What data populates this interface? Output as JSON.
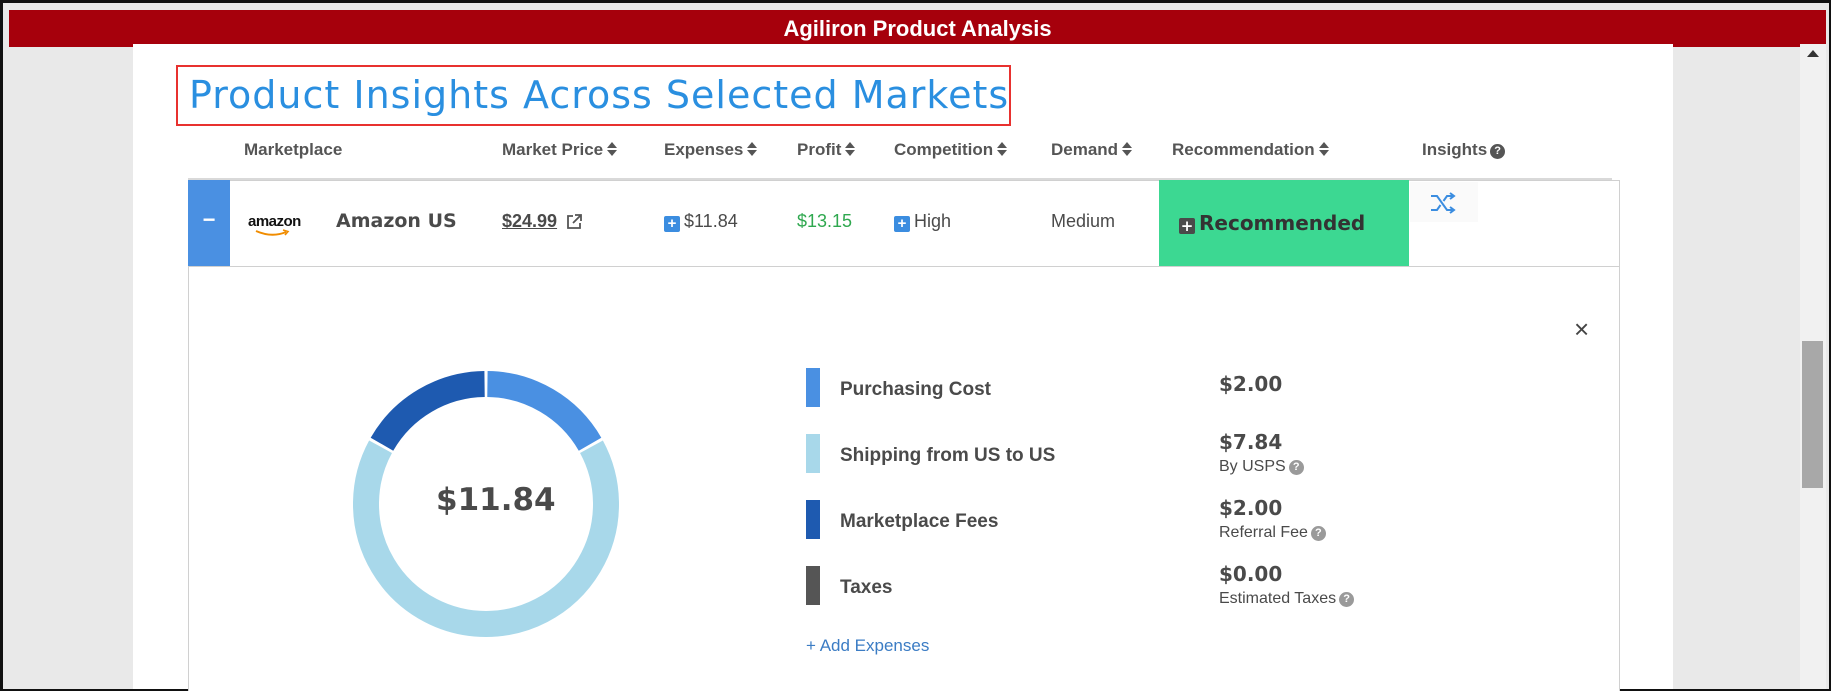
{
  "app": {
    "title": "Agiliron Product Analysis"
  },
  "page": {
    "title": "Product Insights Across Selected Markets"
  },
  "table": {
    "headers": {
      "marketplace": "Marketplace",
      "market_price": "Market Price",
      "expenses": "Expenses",
      "profit": "Profit",
      "competition": "Competition",
      "demand": "Demand",
      "recommendation": "Recommendation",
      "insights": "Insights"
    },
    "row": {
      "toggle": "−",
      "logo_text": "amazon",
      "marketplace": "Amazon US",
      "market_price": "$24.99",
      "expenses": "$11.84",
      "profit": "$13.15",
      "competition": "High",
      "demand": "Medium",
      "recommendation": "Recommended"
    }
  },
  "detail": {
    "close": "×",
    "total": "$11.84",
    "expenses": [
      {
        "label": "Purchasing Cost",
        "value": "$2.00",
        "sub": "",
        "color": "#4a90e2"
      },
      {
        "label": "Shipping from US to US",
        "value": "$7.84",
        "sub": "By USPS",
        "color": "#a8d8ea"
      },
      {
        "label": "Marketplace Fees",
        "value": "$2.00",
        "sub": "Referral Fee",
        "color": "#1e5ab0"
      },
      {
        "label": "Taxes",
        "value": "$0.00",
        "sub": "Estimated Taxes",
        "color": "#555555"
      }
    ],
    "add_expenses": "+ Add Expenses"
  },
  "chart_data": {
    "type": "pie",
    "categories": [
      "Purchasing Cost",
      "Shipping from US to US",
      "Marketplace Fees",
      "Taxes"
    ],
    "values": [
      2.0,
      7.84,
      2.0,
      0.0
    ],
    "colors": [
      "#4a90e2",
      "#a8d8ea",
      "#1e5ab0",
      "#555555"
    ],
    "donut": true,
    "center_label": "$11.84"
  },
  "colors": {
    "titlebar": "#a6000c",
    "accent": "#2a8fe0",
    "recommended": "#3cd892",
    "profit": "#2fa84f"
  },
  "icons": {
    "external_link": "external-link-icon",
    "shuffle": "shuffle-icon",
    "help": "question-circle-icon",
    "plus": "plus-square-icon"
  }
}
